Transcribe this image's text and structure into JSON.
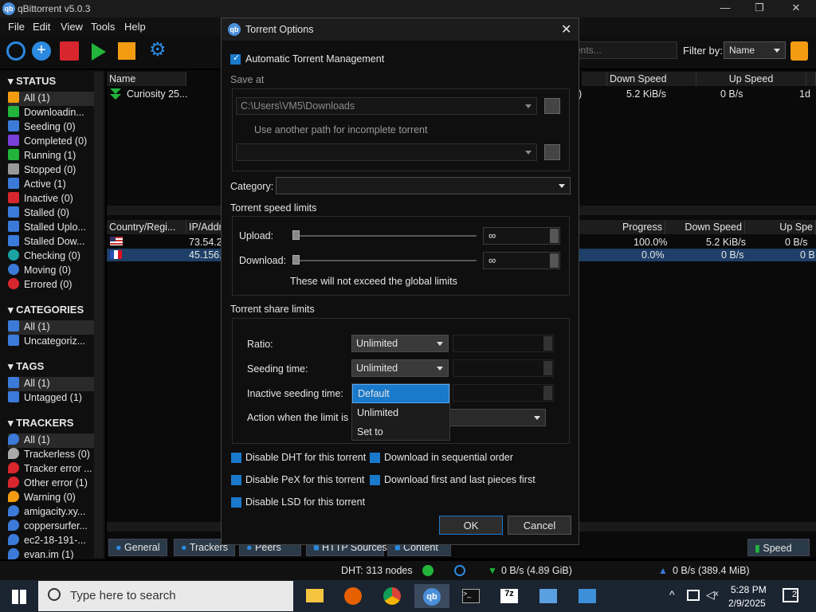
{
  "window": {
    "title": "qBittorrent v5.0.3"
  },
  "menu": [
    "File",
    "Edit",
    "View",
    "Tools",
    "Help"
  ],
  "toolbar": {
    "search_placeholder": "ents...",
    "filter_label": "Filter by:",
    "filter_value": "Name"
  },
  "sidebar": {
    "status_head": "STATUS",
    "status": [
      "All (1)",
      "Downloadin...",
      "Seeding (0)",
      "Completed (0)",
      "Running (1)",
      "Stopped (0)",
      "Active (1)",
      "Inactive (0)",
      "Stalled (0)",
      "Stalled Uplo...",
      "Stalled Dow...",
      "Checking (0)",
      "Moving (0)",
      "Errored (0)"
    ],
    "categories_head": "CATEGORIES",
    "categories": [
      "All (1)",
      "Uncategoriz..."
    ],
    "tags_head": "TAGS",
    "tags": [
      "All (1)",
      "Untagged (1)"
    ],
    "trackers_head": "TRACKERS",
    "trackers": [
      "All (1)",
      "Trackerless (0)",
      "Tracker error ...",
      "Other error (1)",
      "Warning (0)",
      "amigacity.xy...",
      "coppersurfer...",
      "ec2-18-191-...",
      "evan.im (1)"
    ]
  },
  "transfers": {
    "col_name": "Name",
    "col_down": "Down Speed",
    "col_up": "Up Speed",
    "row_name": "Curiosity 25...",
    "row_paren": ")",
    "row_down": "5.2 KiB/s",
    "row_up": "0 B/s",
    "row_eta": "1d"
  },
  "peers": {
    "col_country": "Country/Regi...",
    "col_ip": "IP/Addr",
    "col_progress": "Progress",
    "col_down": "Down Speed",
    "col_up": "Up Spe",
    "rows": [
      {
        "ip": "73.54.20",
        "progress": "100.0%",
        "down": "5.2 KiB/s",
        "up": "0 B/s"
      },
      {
        "ip": "45.156.1",
        "progress": "0.0%",
        "down": "0 B/s",
        "up": "0 B"
      }
    ]
  },
  "tabs": [
    "General",
    "Trackers",
    "Peers",
    "HTTP Sources",
    "Content"
  ],
  "speed_tab": "Speed",
  "statusbar": {
    "dht": "DHT: 313 nodes",
    "down": "0 B/s (4.89 GiB)",
    "up": "0 B/s (389.4 MiB)"
  },
  "taskbar": {
    "search": "Type here to search",
    "time": "5:28 PM",
    "date": "2/9/2025",
    "notif": "2"
  },
  "dialog": {
    "title": "Torrent Options",
    "auto_mgmt": "Automatic Torrent Management",
    "save_at": "Save at",
    "save_path": "C:\\Users\\VM5\\Downloads",
    "incomplete": "Use another path for incomplete torrent",
    "category": "Category:",
    "speed_group": "Torrent speed limits",
    "upload": "Upload:",
    "upload_val": "∞",
    "download": "Download:",
    "download_val": "∞",
    "global_note": "These will not exceed the global limits",
    "share_group": "Torrent share limits",
    "ratio": "Ratio:",
    "ratio_val": "Unlimited",
    "seeding_time": "Seeding time:",
    "seeding_val": "Unlimited",
    "inactive_time": "Inactive seeding time:",
    "dropdown": [
      "Default",
      "Unlimited",
      "Set to"
    ],
    "action": "Action when the limit is r",
    "dht": "Disable DHT for this torrent",
    "pex": "Disable PeX for this torrent",
    "lsd": "Disable LSD for this torrent",
    "sequential": "Download in sequential order",
    "first_last": "Download first and last pieces first",
    "ok": "OK",
    "cancel": "Cancel"
  }
}
